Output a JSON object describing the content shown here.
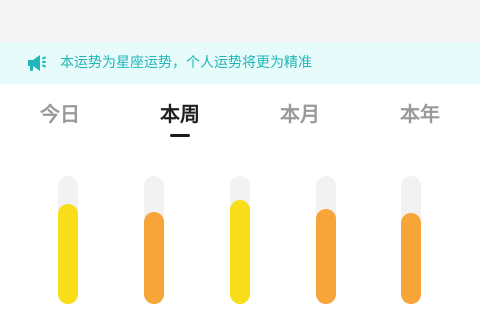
{
  "notice": {
    "icon": "megaphone-icon",
    "text": "本运势为星座运势，个人运势将更为精准",
    "color": "#20b6b9",
    "background": "#e7fbfb"
  },
  "tabs": [
    {
      "label": "今日",
      "active": false
    },
    {
      "label": "本周",
      "active": true
    },
    {
      "label": "本月",
      "active": false
    },
    {
      "label": "本年",
      "active": false
    }
  ],
  "fortune_bars": [
    {
      "level": 0.78,
      "color": "#f7de18"
    },
    {
      "level": 0.72,
      "color": "#f7a438"
    },
    {
      "level": 0.81,
      "color": "#f7de18"
    },
    {
      "level": 0.74,
      "color": "#f7a438"
    },
    {
      "level": 0.71,
      "color": "#f7a438"
    }
  ]
}
